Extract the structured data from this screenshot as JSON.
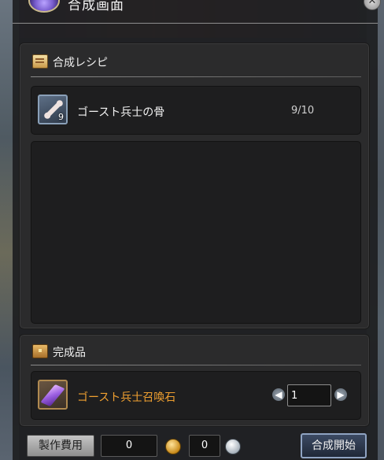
{
  "window": {
    "title": "合成画面",
    "close_glyph": "✕"
  },
  "recipe": {
    "section_title": "合成レシピ",
    "icon": "scroll-icon",
    "materials": [
      {
        "name": "ゴースト兵士の骨",
        "icon": "bone-icon",
        "slot_qty": "9",
        "count": "9/10"
      }
    ]
  },
  "result": {
    "section_title": "完成品",
    "icon": "chest-icon",
    "item": {
      "name": "ゴースト兵士召喚石",
      "icon": "crystal-icon",
      "name_color": "#f0a030"
    },
    "quantity": "1",
    "decrease_glyph": "◀",
    "increase_glyph": "▶"
  },
  "footer": {
    "cost_label": "製作費用",
    "gold_cost": "0",
    "silver_cost": "0",
    "start_label": "合成開始"
  }
}
